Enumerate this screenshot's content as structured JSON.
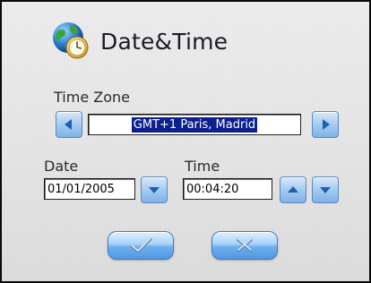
{
  "dialog": {
    "title": "Date&Time",
    "header_icon": "globe-clock-icon"
  },
  "timezone": {
    "label": "Time Zone",
    "value": "GMT+1 Paris, Madrid",
    "prev_icon": "triangle-left-icon",
    "next_icon": "triangle-right-icon"
  },
  "date": {
    "label": "Date",
    "value": "01/01/2005",
    "picker_icon": "triangle-down-icon"
  },
  "time": {
    "label": "Time",
    "value": "00:04:20",
    "up_icon": "triangle-up-icon",
    "down_icon": "triangle-down-icon"
  },
  "actions": {
    "ok_icon": "checkmark-icon",
    "cancel_icon": "x-icon"
  },
  "colors": {
    "selection": "#0b1f8f",
    "button_blue": "#7fb2e7",
    "arrow_blue": "#1e5fb0"
  }
}
